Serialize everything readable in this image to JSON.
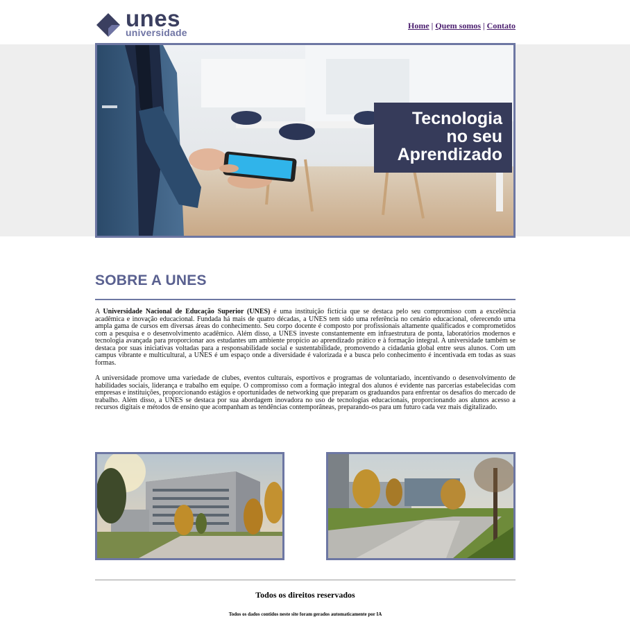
{
  "header": {
    "logo_word": "unes",
    "logo_sub": "universidade",
    "nav": {
      "home": "Home",
      "about": "Quem somos",
      "contact": "Contato",
      "separator": "|"
    }
  },
  "hero": {
    "tag_line_1": "Tecnologia",
    "tag_line_2": "no seu",
    "tag_line_3": "Aprendizado"
  },
  "about": {
    "title": "SOBRE A UNES",
    "p1_prefix": "A ",
    "p1_bold": "Universidade Nacional de Educação Superior (UNES)",
    "p1_rest": " é uma instituição fictícia que se destaca pelo seu compromisso com a excelência acadêmica e inovação educacional. Fundada há mais de quatro décadas, a UNES tem sido uma referência no cenário educacional, oferecendo uma ampla gama de cursos em diversas áreas do conhecimento. Seu corpo docente é composto por profissionais altamente qualificados e comprometidos com a pesquisa e o desenvolvimento acadêmico. Além disso, a UNES investe constantemente em infraestrutura de ponta, laboratórios modernos e tecnologia avançada para proporcionar aos estudantes um ambiente propício ao aprendizado prático e à formação integral. A universidade também se destaca por suas iniciativas voltadas para a responsabilidade social e sustentabilidade, promovendo a cidadania global entre seus alunos. Com um campus vibrante e multicultural, a UNES é um espaço onde a diversidade é valorizada e a busca pelo conhecimento é incentivada em todas as suas formas.",
    "p2": "A universidade promove uma variedade de clubes, eventos culturais, esportivos e programas de voluntariado, incentivando o desenvolvimento de habilidades sociais, liderança e trabalho em equipe. O compromisso com a formação integral dos alunos é evidente nas parcerias estabelecidas com empresas e instituições, proporcionando estágios e oportunidades de networking que preparam os graduandos para enfrentar os desafios do mercado de trabalho. Além disso, a UNES se destaca por sua abordagem inovadora no uso de tecnologias educacionais, proporcionando aos alunos acesso a recursos digitais e métodos de ensino que acompanham as tendências contemporâneas, preparando-os para um futuro cada vez mais digitalizado."
  },
  "footer": {
    "rights": "Todos os direitos reservados",
    "note": "Todos os dados contidos neste site foram gerados automaticamente por IA"
  },
  "colors": {
    "brand_dark": "#3b3f60",
    "brand_light": "#6f74a4",
    "accent_border": "#6d77a3",
    "title_color": "#5a6190",
    "link_color": "#4a1d6e"
  }
}
